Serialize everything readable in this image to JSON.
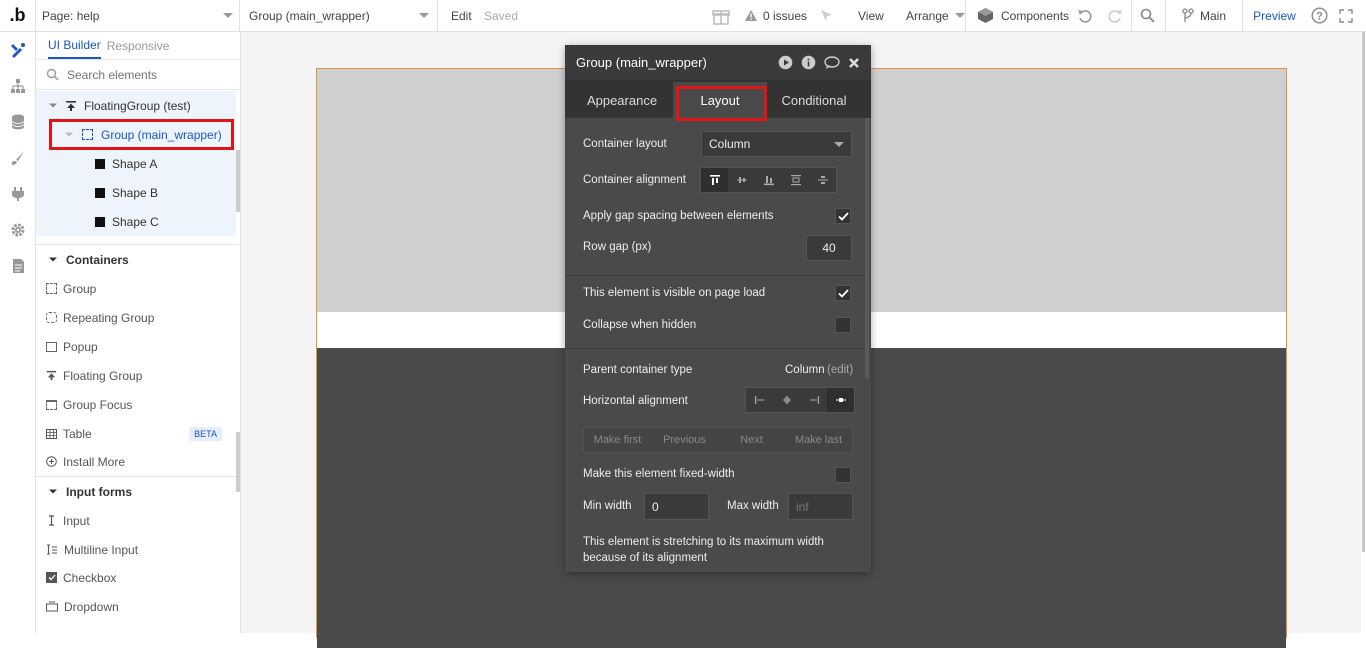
{
  "topbar": {
    "logo": ".b",
    "page_label": "Page: help",
    "element_label": "Group (main_wrapper)",
    "edit": "Edit",
    "saved": "Saved",
    "issues": "0 issues",
    "view": "View",
    "arrange": "Arrange",
    "components": "Components",
    "branch": "Main",
    "preview": "Preview"
  },
  "panel": {
    "tabs": [
      {
        "label": "UI Builder"
      },
      {
        "label": "Responsive"
      }
    ],
    "search_placeholder": "Search elements",
    "tree": [
      {
        "label": "FloatingGroup (test)"
      },
      {
        "label": "Group (main_wrapper)"
      },
      {
        "label": "Shape A"
      },
      {
        "label": "Shape B"
      },
      {
        "label": "Shape C"
      }
    ],
    "containers_title": "Containers",
    "containers": [
      {
        "label": "Group"
      },
      {
        "label": "Repeating Group"
      },
      {
        "label": "Popup"
      },
      {
        "label": "Floating Group"
      },
      {
        "label": "Group Focus"
      },
      {
        "label": "Table",
        "badge": "BETA"
      },
      {
        "label": "Install More"
      }
    ],
    "inputs_title": "Input forms",
    "inputs": [
      {
        "label": "Input"
      },
      {
        "label": "Multiline Input"
      },
      {
        "label": "Checkbox"
      },
      {
        "label": "Dropdown"
      }
    ]
  },
  "inspector": {
    "title": "Group (main_wrapper)",
    "tabs": [
      {
        "label": "Appearance"
      },
      {
        "label": "Layout"
      },
      {
        "label": "Conditional"
      }
    ],
    "container_layout_label": "Container layout",
    "container_layout_value": "Column",
    "container_alignment_label": "Container alignment",
    "gap_label": "Apply gap spacing between elements",
    "row_gap_label": "Row gap (px)",
    "row_gap_value": "40",
    "visible_label": "This element is visible on page load",
    "collapse_label": "Collapse when hidden",
    "parent_type_label": "Parent container type",
    "parent_type_value": "Column",
    "parent_type_edit": "(edit)",
    "horiz_align_label": "Horizontal alignment",
    "order_buttons": [
      {
        "label": "Make first"
      },
      {
        "label": "Previous"
      },
      {
        "label": "Next"
      },
      {
        "label": "Make last"
      }
    ],
    "fixed_width_label": "Make this element fixed-width",
    "min_width_label": "Min width",
    "min_width_value": "0",
    "max_width_label": "Max width",
    "max_width_placeholder": "inf",
    "stretch_note": "This element is stretching to its maximum width because of its alignment"
  },
  "colors": {
    "accent": "#1a56c4",
    "highlight": "#e01515",
    "frame": "#e3933f"
  }
}
